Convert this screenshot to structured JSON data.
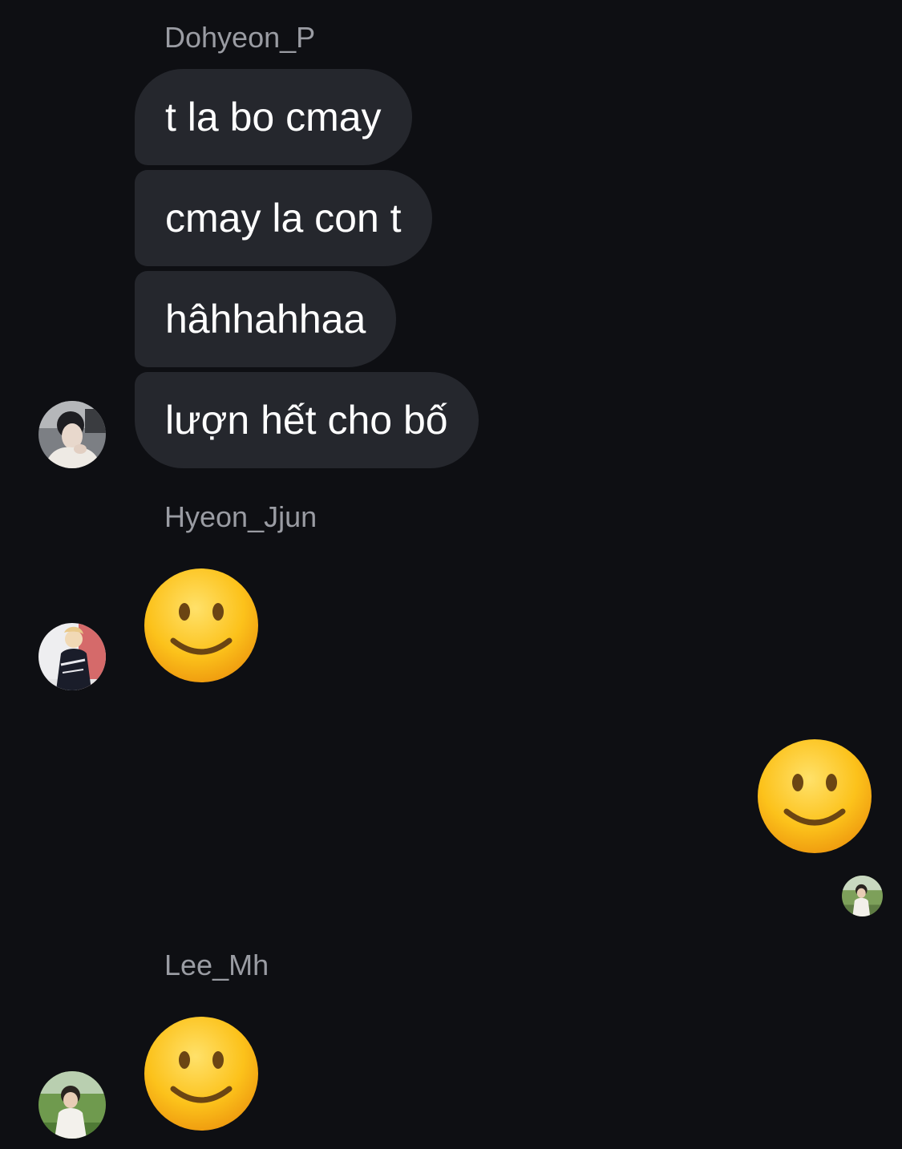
{
  "colors": {
    "background": "#0e0f13",
    "bubble": "#25272d",
    "bubble_text": "#ffffff",
    "sender_name": "#9a9ca3"
  },
  "groups": [
    {
      "sender": "Dohyeon_P",
      "avatar_icon": "user-photo-avatar",
      "messages": [
        "t la bo cmay",
        "cmay la con t",
        "hâhhahhaa",
        "lượn hết cho bố"
      ]
    },
    {
      "sender": "Hyeon_Jjun",
      "avatar_icon": "user-photo-avatar",
      "reaction": "slightly-smiling-face-emoji"
    },
    {
      "sender": "",
      "avatar_icon": "seen-receipt-avatar",
      "reaction": "slightly-smiling-face-emoji",
      "outgoing": true
    },
    {
      "sender": "Lee_Mh",
      "avatar_icon": "user-photo-avatar",
      "reaction": "slightly-smiling-face-emoji"
    }
  ]
}
